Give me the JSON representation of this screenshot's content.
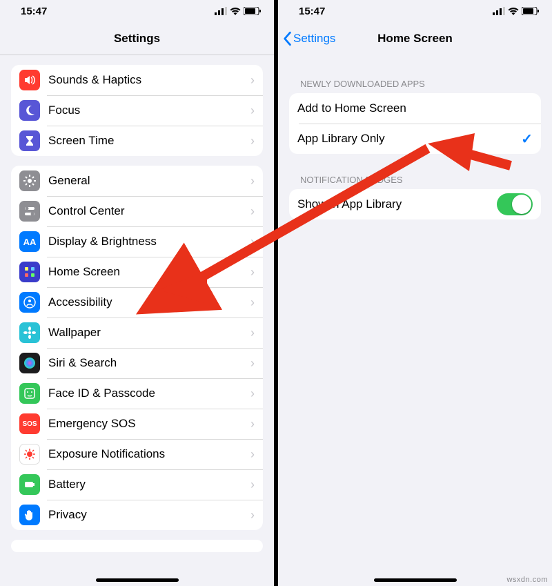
{
  "status": {
    "time": "15:47"
  },
  "left": {
    "title": "Settings",
    "group1": [
      {
        "key": "sounds",
        "label": "Sounds & Haptics",
        "bg": "#ff3b30",
        "glyph": "vol"
      },
      {
        "key": "focus",
        "label": "Focus",
        "bg": "#5856d6",
        "glyph": "moon"
      },
      {
        "key": "screentime",
        "label": "Screen Time",
        "bg": "#5856d6",
        "glyph": "hourglass"
      }
    ],
    "group2": [
      {
        "key": "general",
        "label": "General",
        "bg": "#8e8e93",
        "glyph": "gear"
      },
      {
        "key": "controlcenter",
        "label": "Control Center",
        "bg": "#8e8e93",
        "glyph": "switches"
      },
      {
        "key": "display",
        "label": "Display & Brightness",
        "bg": "#007aff",
        "glyph": "AA"
      },
      {
        "key": "homescreen",
        "label": "Home Screen",
        "bg": "#3a3cca",
        "glyph": "grid"
      },
      {
        "key": "accessibility",
        "label": "Accessibility",
        "bg": "#007aff",
        "glyph": "person"
      },
      {
        "key": "wallpaper",
        "label": "Wallpaper",
        "bg": "#29c2d6",
        "glyph": "flower"
      },
      {
        "key": "siri",
        "label": "Siri & Search",
        "bg": "#1c1c1e",
        "glyph": "siri"
      },
      {
        "key": "faceid",
        "label": "Face ID & Passcode",
        "bg": "#34c759",
        "glyph": "face"
      },
      {
        "key": "sos",
        "label": "Emergency SOS",
        "bg": "#ff3b30",
        "glyph": "SOS"
      },
      {
        "key": "exposure",
        "label": "Exposure Notifications",
        "bg": "#ffffff",
        "glyph": "covid"
      },
      {
        "key": "battery",
        "label": "Battery",
        "bg": "#34c759",
        "glyph": "battery"
      },
      {
        "key": "privacy",
        "label": "Privacy",
        "bg": "#007aff",
        "glyph": "hand"
      }
    ]
  },
  "right": {
    "back": "Settings",
    "title": "Home Screen",
    "section1_header": "NEWLY DOWNLOADED APPS",
    "section1": [
      {
        "key": "addhome",
        "label": "Add to Home Screen",
        "selected": false
      },
      {
        "key": "applib",
        "label": "App Library Only",
        "selected": true
      }
    ],
    "section2_header": "NOTIFICATION BADGES",
    "section2_row_label": "Show in App Library",
    "section2_toggle_on": true
  },
  "watermark": "wsxdn.com"
}
